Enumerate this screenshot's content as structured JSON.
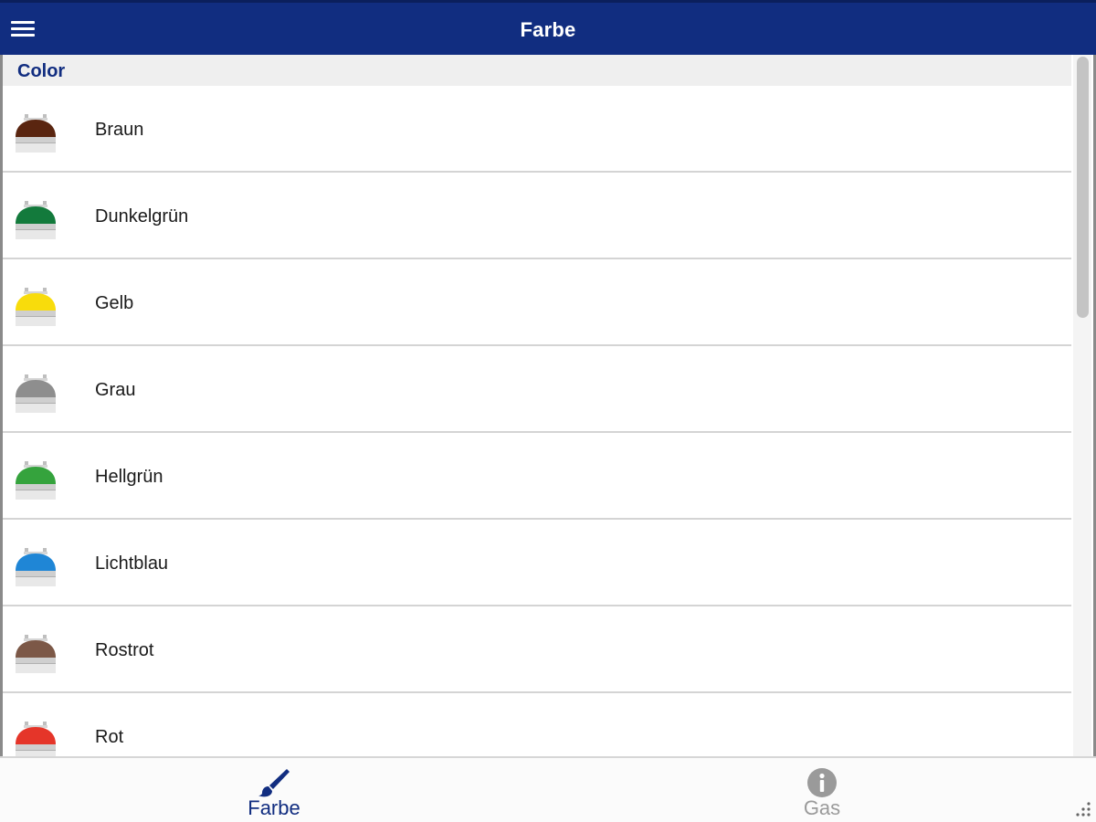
{
  "header": {
    "title": "Farbe",
    "menu_icon": "hamburger-icon"
  },
  "section": {
    "title": "Color"
  },
  "items": [
    {
      "label": "Braun",
      "color": "#5a2510"
    },
    {
      "label": "Dunkelgrün",
      "color": "#137a3c"
    },
    {
      "label": "Gelb",
      "color": "#f8dc0c"
    },
    {
      "label": "Grau",
      "color": "#8e8e8e"
    },
    {
      "label": "Hellgrün",
      "color": "#35a33d"
    },
    {
      "label": "Lichtblau",
      "color": "#1f86d6"
    },
    {
      "label": "Rostrot",
      "color": "#7c5847"
    },
    {
      "label": "Rot",
      "color": "#e53529"
    }
  ],
  "tabs": [
    {
      "label": "Farbe",
      "icon": "paintbrush-icon",
      "active": true
    },
    {
      "label": "Gas",
      "icon": "info-icon",
      "active": false
    }
  ],
  "colors": {
    "header_bg": "#112d80",
    "accent": "#112d80",
    "inactive": "#9a9a9a"
  }
}
